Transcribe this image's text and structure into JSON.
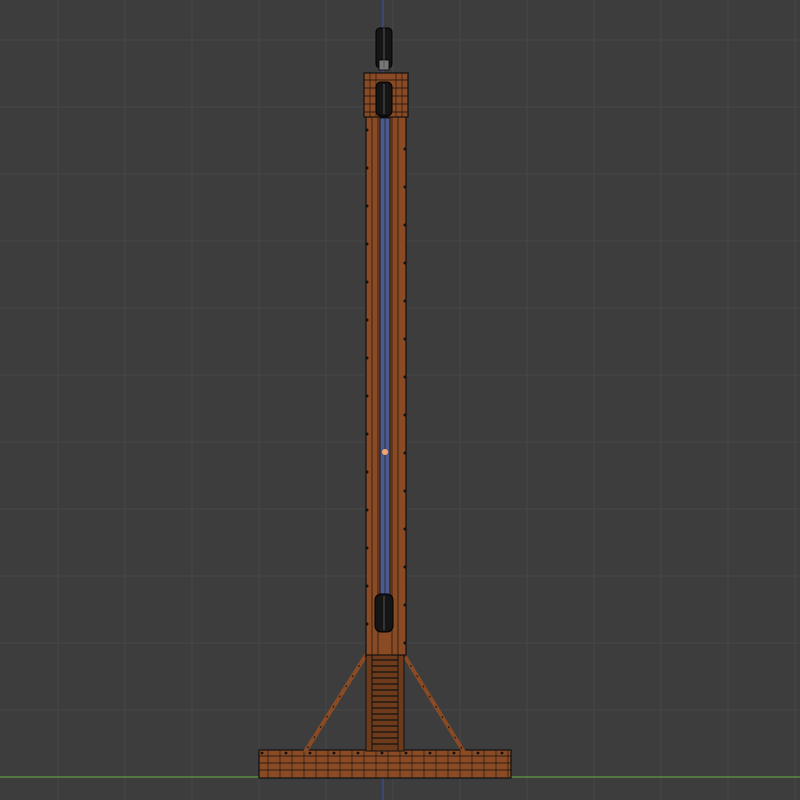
{
  "viewport": {
    "background": "#3d3d3d",
    "grid_color": "#474747",
    "x_axis_color": "#5e9c3f",
    "z_axis_color": "#3b4f9b",
    "origin_color": "#f5a66b"
  },
  "model": {
    "wood_color": "#8a4a24",
    "wood_dark": "#6e3a1c",
    "edge_color": "#111111",
    "slot_color": "#4d5a8c",
    "hardware_color": "#151515"
  }
}
